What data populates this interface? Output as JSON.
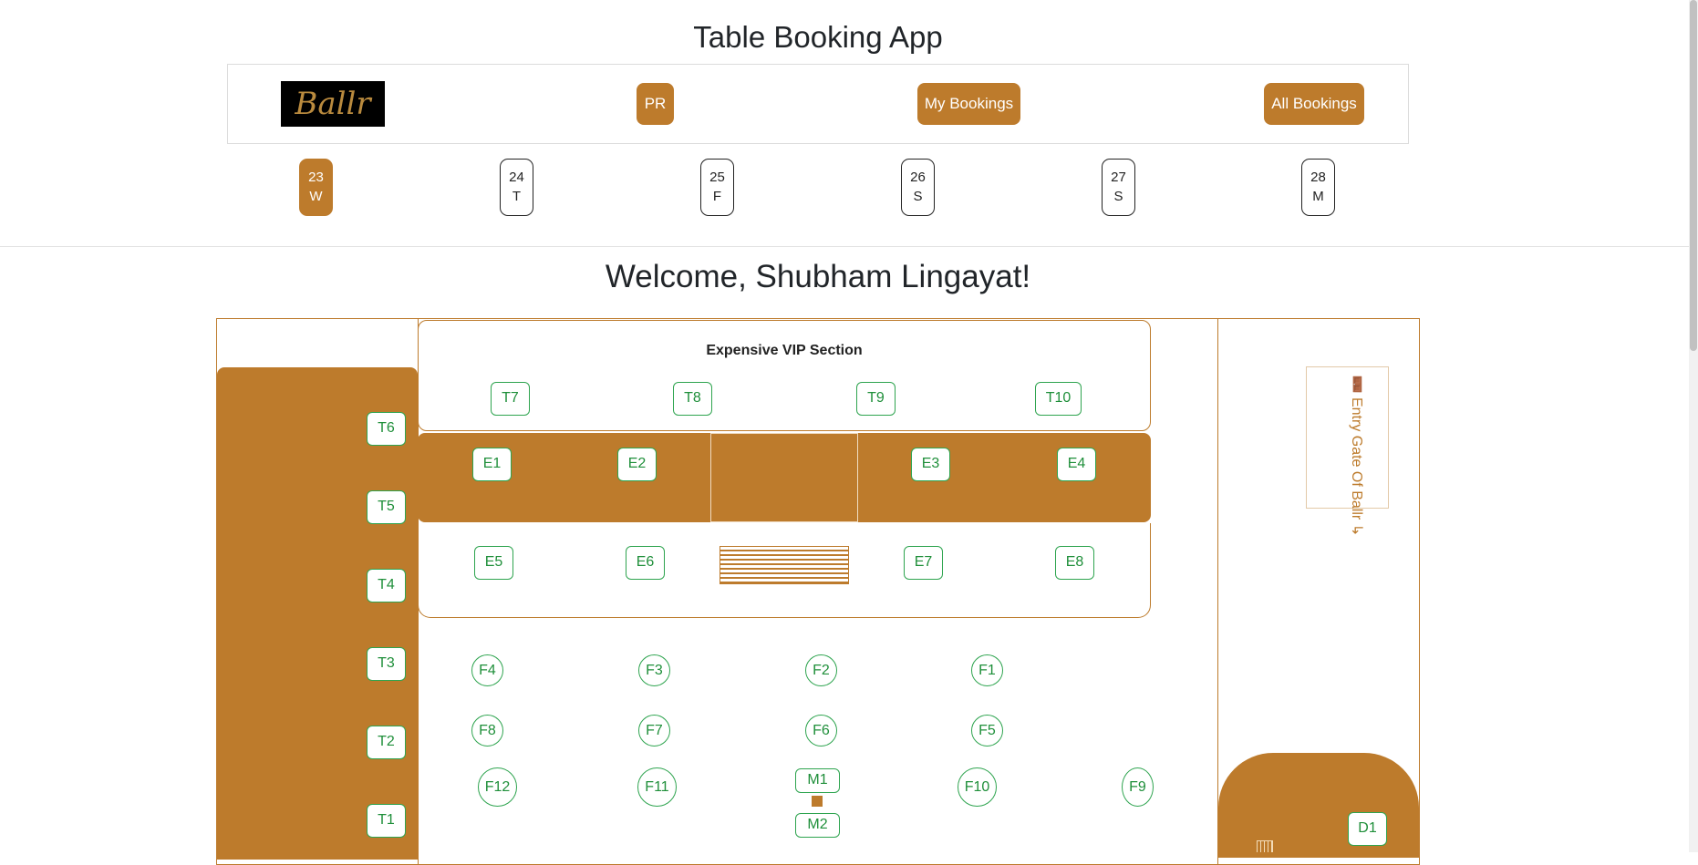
{
  "app_title": "Table Booking App",
  "logo_text": "Ballr",
  "nav": {
    "pr_label": "PR",
    "my_bookings": "My Bookings",
    "all_bookings": "All Bookings"
  },
  "dates": [
    {
      "day": "23",
      "weekday": "W",
      "active": true
    },
    {
      "day": "24",
      "weekday": "T"
    },
    {
      "day": "25",
      "weekday": "F"
    },
    {
      "day": "26",
      "weekday": "S"
    },
    {
      "day": "27",
      "weekday": "S"
    },
    {
      "day": "28",
      "weekday": "M"
    }
  ],
  "welcome": "Welcome, Shubham Lingayat!",
  "vip_title": "Expensive VIP Section",
  "entry_gate": "🚪 Entry Gate Of Ballr ↳",
  "tables": {
    "t1": "T1",
    "t2": "T2",
    "t3": "T3",
    "t4": "T4",
    "t5": "T5",
    "t6": "T6",
    "t7": "T7",
    "t8": "T8",
    "t9": "T9",
    "t10": "T10",
    "e1": "E1",
    "e2": "E2",
    "e3": "E3",
    "e4": "E4",
    "e5": "E5",
    "e6": "E6",
    "e7": "E7",
    "e8": "E8",
    "f1": "F1",
    "f2": "F2",
    "f3": "F3",
    "f4": "F4",
    "f5": "F5",
    "f6": "F6",
    "f7": "F7",
    "f8": "F8",
    "f9": "F9",
    "f10": "F10",
    "f11": "F11",
    "f12": "F12",
    "m1": "M1",
    "m2": "M2",
    "d1": "D1"
  },
  "colors": {
    "accent": "#bd7b2c",
    "table_border": "#2ea44f"
  }
}
